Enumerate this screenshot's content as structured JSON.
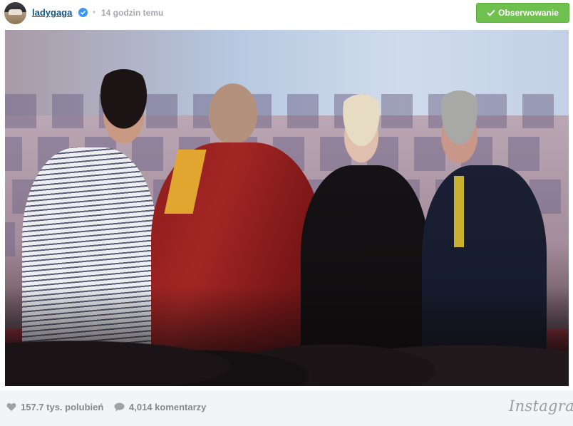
{
  "header": {
    "username": "ladygaga",
    "separator": "•",
    "time": "14 godzin temu",
    "follow_label": "Obserwowanie"
  },
  "footer": {
    "likes": "157.7 tys. polubień",
    "comments": "4,014 komentarzy",
    "brand": "Instagram"
  },
  "icons": {
    "avatar": "profile-avatar",
    "verified": "verified-badge-icon",
    "check": "check-icon",
    "heart": "heart-icon",
    "comment": "comment-bubble-icon"
  },
  "colors": {
    "username": "#125688",
    "follow_button": "#70c050",
    "footer_bg": "#f3f4f6",
    "meta_text": "#85888c"
  }
}
